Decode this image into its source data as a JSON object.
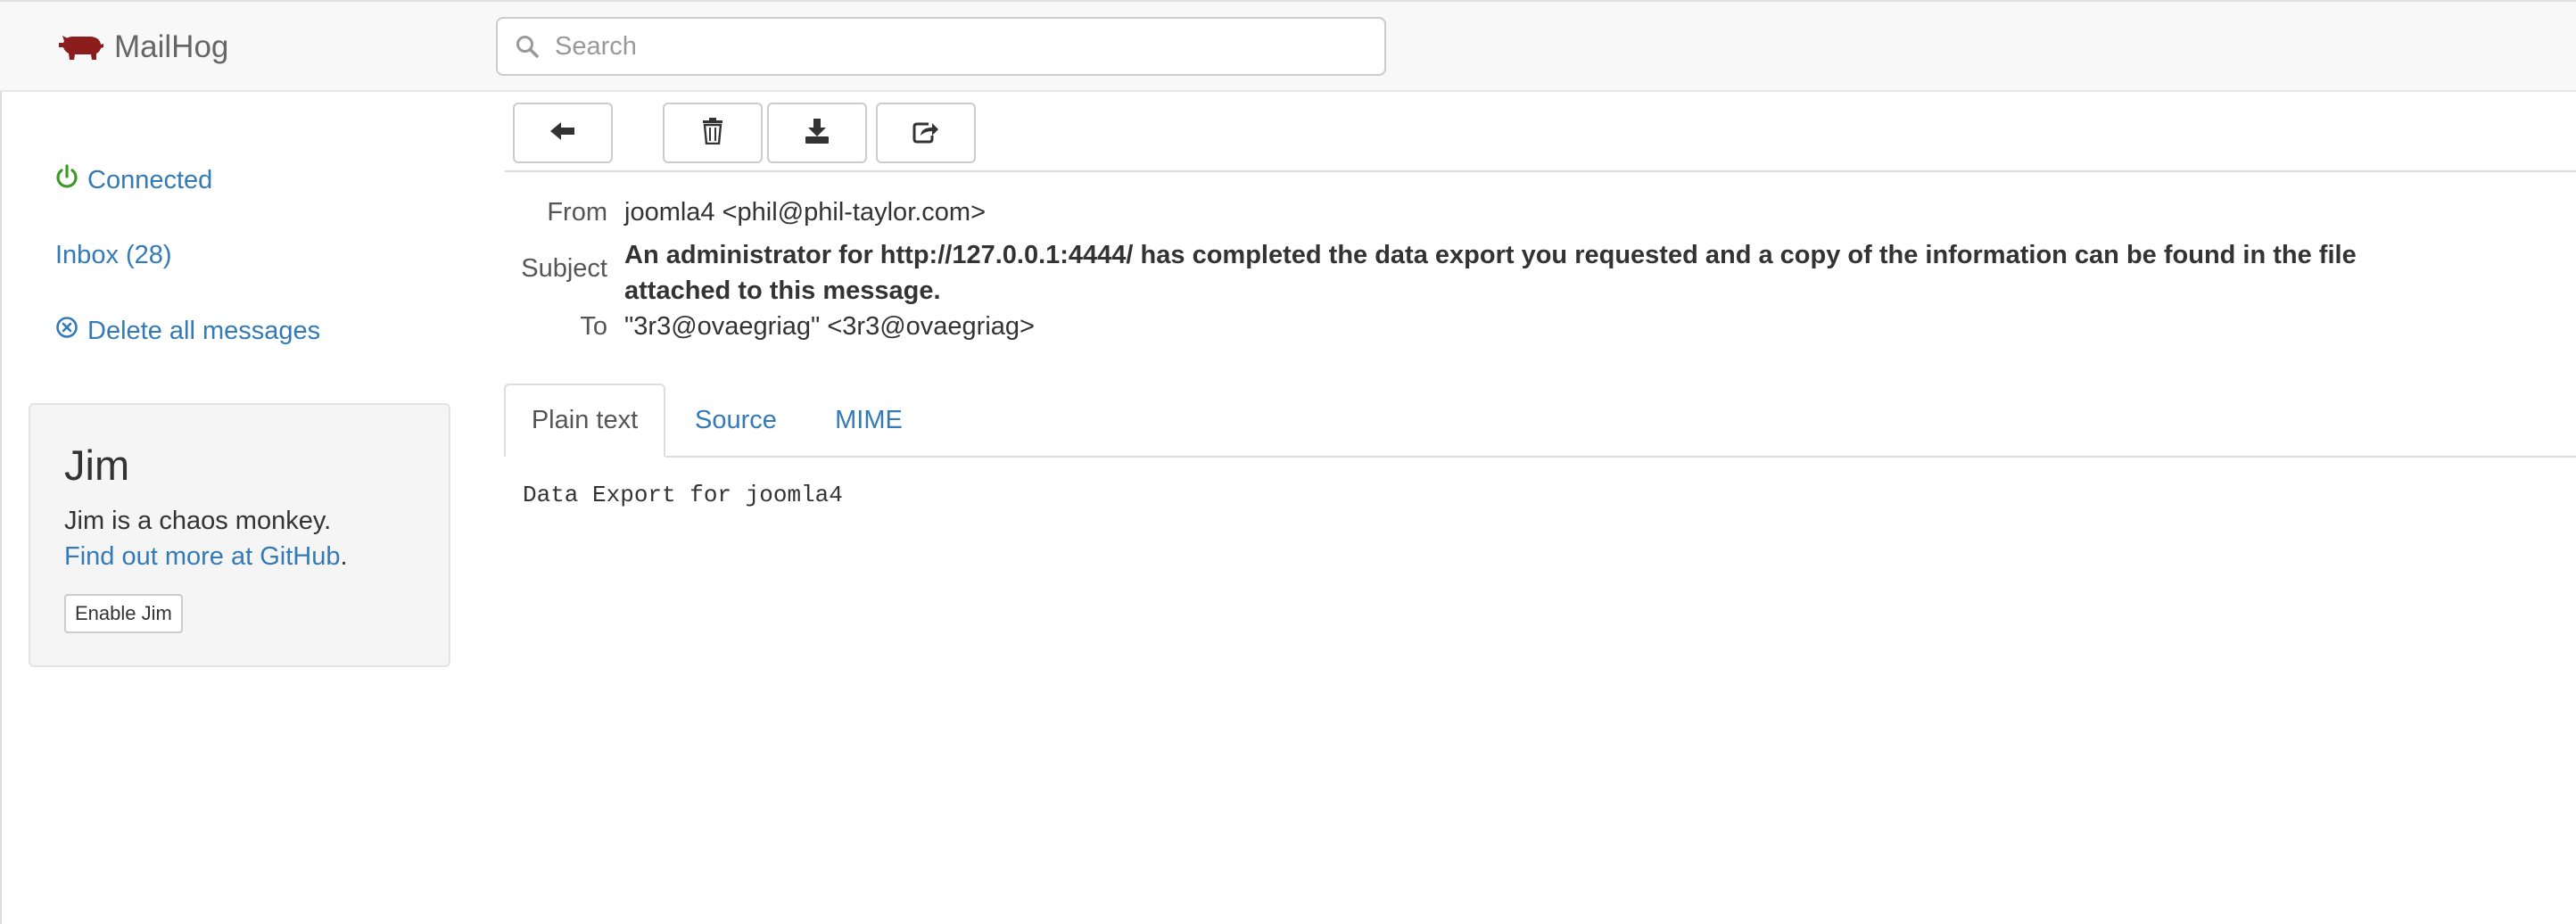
{
  "app": {
    "brand_name": "MailHog",
    "brand_color": "#8b1d1d"
  },
  "search": {
    "placeholder": "Search",
    "value": ""
  },
  "sidebar": {
    "connected_label": "Connected",
    "connected_color": "#3c9a29",
    "inbox_label": "Inbox (28)",
    "delete_all_label": "Delete all messages"
  },
  "jim": {
    "title": "Jim",
    "description": "Jim is a chaos monkey.",
    "link_text": "Find out more at GitHub",
    "link_suffix": ".",
    "enable_button": "Enable Jim"
  },
  "toolbar": {
    "buttons": [
      {
        "name": "back",
        "icon": "arrow-left-icon"
      },
      {
        "name": "delete",
        "icon": "trash-icon"
      },
      {
        "name": "download",
        "icon": "download-icon"
      },
      {
        "name": "release",
        "icon": "share-icon"
      }
    ]
  },
  "message": {
    "from_label": "From",
    "from_value": "joomla4 <phil@phil-taylor.com>",
    "subject_label": "Subject",
    "subject_value": "An administrator for http://127.0.0.1:4444/ has completed the data export you requested and a copy of the information can be found in the file attached to this message.",
    "to_label": "To",
    "to_value": "\"3r3@ovaegriag\" <3r3@ovaegriag>"
  },
  "tabs": [
    {
      "label": "Plain text",
      "active": true
    },
    {
      "label": "Source",
      "active": false
    },
    {
      "label": "MIME",
      "active": false
    }
  ],
  "body": {
    "plain_text": "Data Export for joomla4"
  }
}
